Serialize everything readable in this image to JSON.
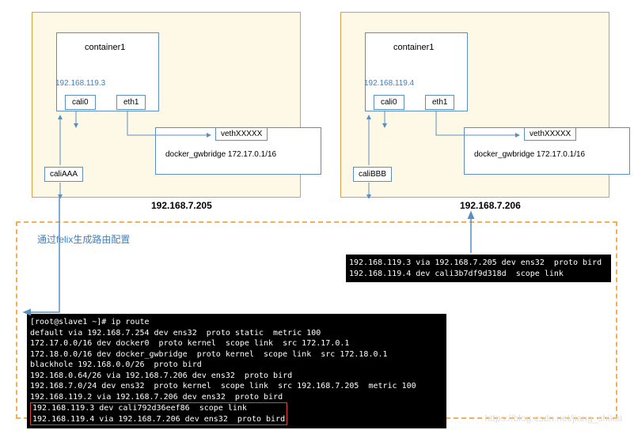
{
  "host1": {
    "container_label": "container1",
    "ip": "192.168.119.3",
    "cali0": "cali0",
    "eth1": "eth1",
    "caliX": "caliAAA",
    "veth": "vethXXXXX",
    "bridge": "docker_gwbridge 172.17.0.1/16",
    "host_ip": "192.168.7.205"
  },
  "host2": {
    "container_label": "container1",
    "ip": "192.168.119.4",
    "cali0": "cali0",
    "eth1": "eth1",
    "caliX": "caliBBB",
    "veth": "vethXXXXX",
    "bridge": "docker_gwbridge 172.17.0.1/16",
    "host_ip": "192.168.7.206"
  },
  "felix_label": "通过felix生成路由配置",
  "term1": {
    "prompt": "[root@slave1 ~]# ip route",
    "l1": "default via 192.168.7.254 dev ens32  proto static  metric 100",
    "l2": "172.17.0.0/16 dev docker0  proto kernel  scope link  src 172.17.0.1",
    "l3": "172.18.0.0/16 dev docker_gwbridge  proto kernel  scope link  src 172.18.0.1",
    "l4": "blackhole 192.168.0.0/26  proto bird",
    "l5": "192.168.0.64/26 via 192.168.7.206 dev ens32  proto bird",
    "l6": "192.168.7.0/24 dev ens32  proto kernel  scope link  src 192.168.7.205  metric 100",
    "l7": "192.168.119.2 via 192.168.7.206 dev ens32  proto bird",
    "h1": "192.168.119.3 dev cali792d36eef86  scope link",
    "h2": "192.168.119.4 via 192.168.7.206 dev ens32  proto bird"
  },
  "term2": {
    "l1": "192.168.119.3 via 192.168.7.205 dev ens32  proto bird",
    "l2": "192.168.119.4 dev cali3b7df9d318d  scope link"
  },
  "watermark": "https://blog.csdn.net/jiang_shikui"
}
